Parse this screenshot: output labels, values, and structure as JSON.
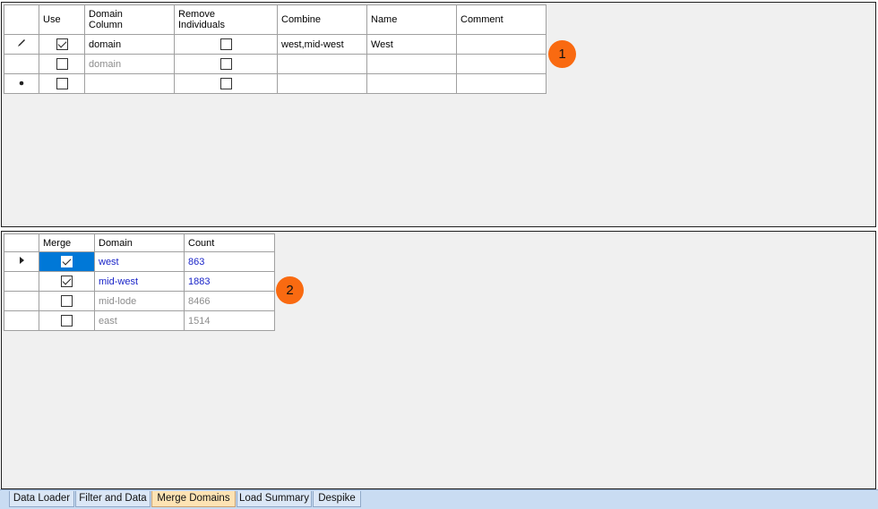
{
  "top_grid": {
    "headers": {
      "use": "Use",
      "domain_col_1": "Domain",
      "domain_col_2": "Column",
      "remove_1": "Remove",
      "remove_2": "Individuals",
      "combine": "Combine",
      "name": "Name",
      "comment": "Comment"
    },
    "rows": [
      {
        "indicator": "pencil",
        "use": true,
        "domain": "domain",
        "remove": false,
        "combine": "west,mid-west",
        "name": "West",
        "comment": ""
      },
      {
        "indicator": "",
        "use": false,
        "domain": "domain",
        "remove": false,
        "combine": "",
        "name": "",
        "comment": ""
      },
      {
        "indicator": "new-row",
        "use": false,
        "domain": "",
        "remove": false,
        "combine": "",
        "name": "",
        "comment": ""
      }
    ]
  },
  "bottom_grid": {
    "headers": {
      "merge": "Merge",
      "domain": "Domain",
      "count": "Count"
    },
    "rows": [
      {
        "current": true,
        "merge": true,
        "domain": "west",
        "count": "863"
      },
      {
        "current": false,
        "merge": true,
        "domain": "mid-west",
        "count": "1883"
      },
      {
        "current": false,
        "merge": false,
        "domain": "mid-lode",
        "count": "8466"
      },
      {
        "current": false,
        "merge": false,
        "domain": "east",
        "count": "1514"
      }
    ]
  },
  "callouts": {
    "one": "1",
    "two": "2"
  },
  "tabs": [
    {
      "label": "Data Loader",
      "active": false
    },
    {
      "label": "Filter and Data",
      "active": false
    },
    {
      "label": "Merge Domains",
      "active": true
    },
    {
      "label": "Load Summary",
      "active": false
    },
    {
      "label": "Despike",
      "active": false
    }
  ],
  "colors": {
    "callout": "#f96a11",
    "selection": "#0078d7",
    "merged_text": "#1a24c8",
    "active_tab": "#fde3b4"
  }
}
